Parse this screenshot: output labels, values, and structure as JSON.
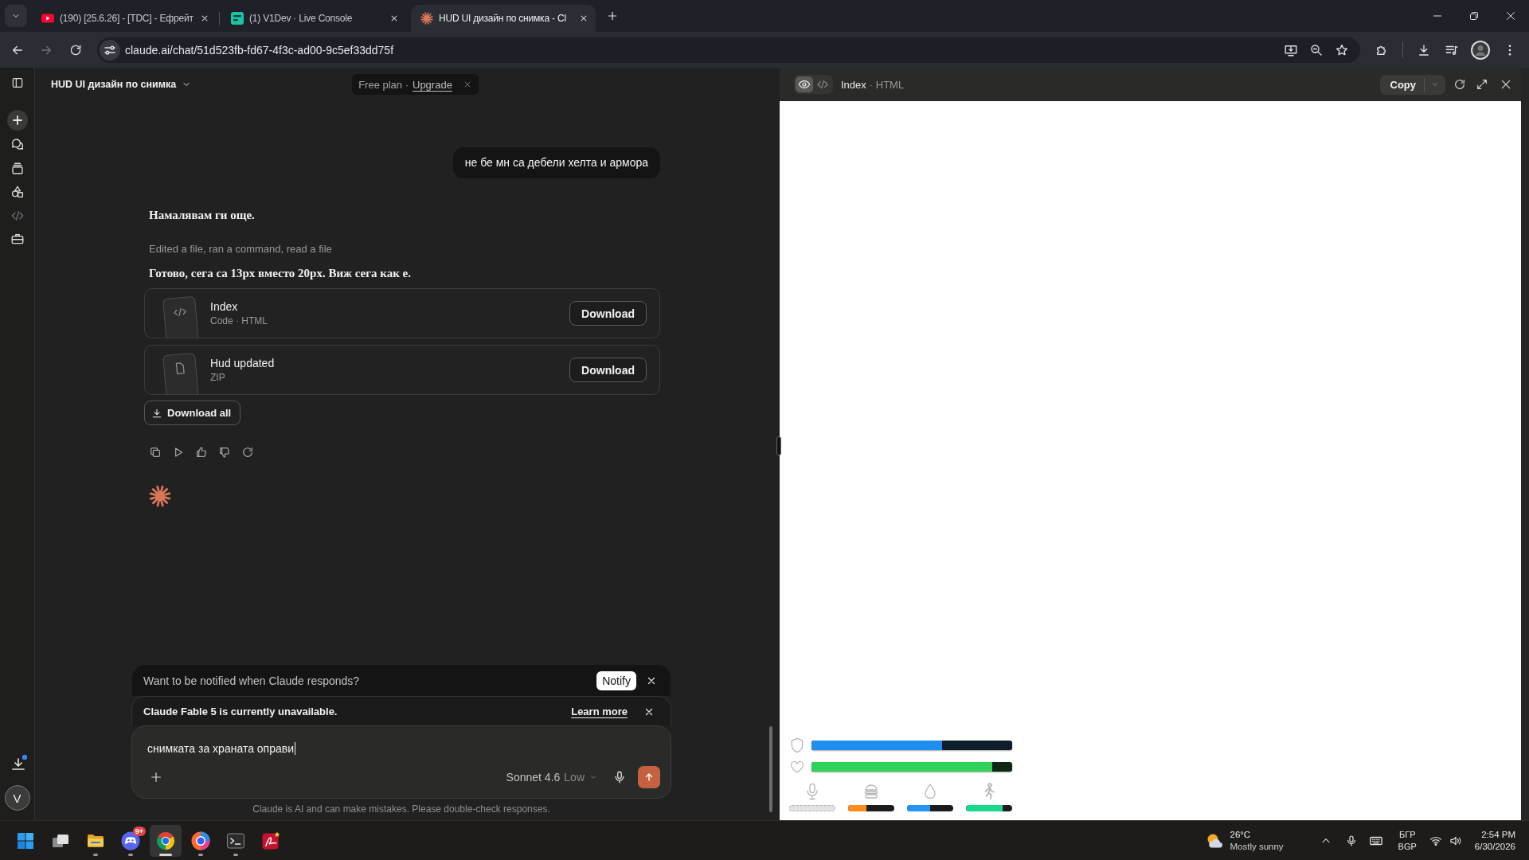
{
  "browser": {
    "tabs": [
      {
        "kind": "video",
        "title": "(190) [25.6.26] - [TDC] - Ефрейт",
        "selected": false
      },
      {
        "kind": "console",
        "title": "(1) V1Dev · Live Console",
        "selected": false
      },
      {
        "kind": "assistant",
        "title": "HUD UI дизайн по снимка - Cl",
        "selected": true
      }
    ],
    "address": "claude.ai/chat/51d523fb-fd67-4f3c-ad00-9c5ef33dd75f"
  },
  "sidebar": {
    "avatar": "V"
  },
  "chat": {
    "title": "HUD UI дизайн по снимка",
    "plan": {
      "label": "Free plan ·",
      "link": "Upgrade"
    },
    "messages": [
      {
        "kind": "user",
        "text": "не бе мн са дебели хелта и армора"
      },
      {
        "kind": "assistant",
        "text": "Намалявам ги още."
      },
      {
        "kind": "activity",
        "text": "Edited a file, ran a command, read a file"
      },
      {
        "kind": "assistant",
        "text": "Готово, сега са 13px вместо 20px. Виж сега как е."
      }
    ],
    "files": [
      {
        "kind": "code",
        "name": "Index",
        "meta": "Code · HTML",
        "button": "Download"
      },
      {
        "kind": "file",
        "name": "Hud updated",
        "meta": "ZIP",
        "button": "Download"
      }
    ],
    "download_all": "Download all",
    "notify": {
      "text": "Want to be notified when Claude responds?",
      "button": "Notify"
    },
    "notice": {
      "text": "Claude Fable 5 is currently unavailable.",
      "link": "Learn more"
    },
    "composer": {
      "value": "снимката за храната оправи",
      "model": "Sonnet 4.6",
      "effort": "Low"
    },
    "disclaimer": "Claude is AI and can make mistakes. Please double-check responses."
  },
  "artifact": {
    "views": [
      {
        "kind": "preview",
        "selected": true
      },
      {
        "kind": "code",
        "selected": false
      }
    ],
    "title": "Index",
    "type": "· HTML",
    "copy": "Copy",
    "hud": {
      "bars": [
        {
          "kind": "armor",
          "level": 0.65,
          "color": "#1e8ff0"
        },
        {
          "kind": "health",
          "level": 0.9,
          "color": "#2fd35a"
        }
      ],
      "meters": [
        {
          "kind": "voice",
          "active": false
        },
        {
          "kind": "hunger",
          "level": 0.39,
          "color": "#ff8c1a"
        },
        {
          "kind": "thirst",
          "level": 0.5,
          "color": "#2196f3"
        },
        {
          "kind": "stamina",
          "level": 0.8,
          "color": "#16d98a"
        }
      ]
    }
  },
  "taskbar": {
    "apps": [
      {
        "kind": "start",
        "running": false,
        "selected": false
      },
      {
        "kind": "task_view",
        "running": false,
        "selected": false
      },
      {
        "kind": "files",
        "running": true,
        "selected": false
      },
      {
        "kind": "chat",
        "running": true,
        "selected": false,
        "badge": "9+"
      },
      {
        "kind": "browser",
        "running": true,
        "selected": true
      },
      {
        "kind": "browser_alt",
        "running": true,
        "selected": false
      },
      {
        "kind": "terminal",
        "running": true,
        "selected": false
      },
      {
        "kind": "editor",
        "running": false,
        "selected": false
      }
    ],
    "weather": {
      "temperature": "26°C",
      "condition": "Mostly sunny"
    },
    "language": [
      "БГР",
      "BGP"
    ],
    "time": "2:54 PM",
    "date": "6/30/2026"
  }
}
